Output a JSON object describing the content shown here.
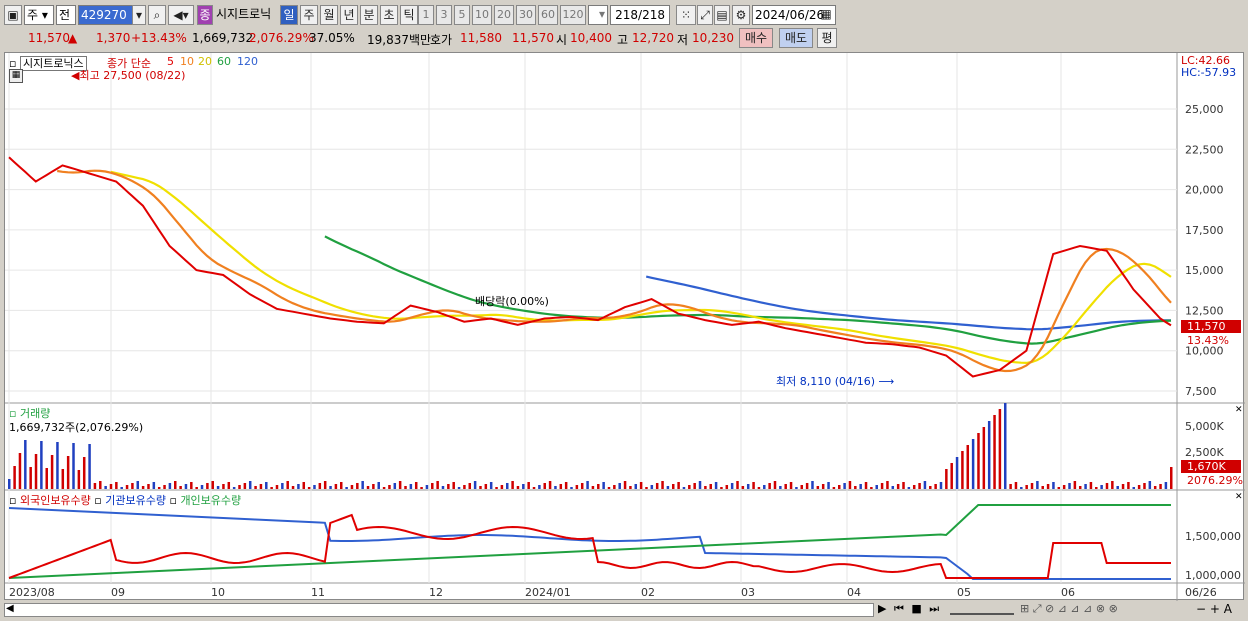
{
  "toolbar": {
    "market_select": "주",
    "type_select": "전",
    "code": "429270",
    "stock_badge": "종",
    "stock_name": "시지트로닉",
    "periods": [
      "일",
      "주",
      "월",
      "년",
      "분",
      "초",
      "틱"
    ],
    "numbers": [
      "1",
      "3",
      "5",
      "10",
      "20",
      "30",
      "60",
      "120"
    ],
    "count": "218/218",
    "date": "2024/06/26"
  },
  "info": {
    "price": "11,570",
    "change": "1,370",
    "change_pct": "+13.43%",
    "volume": "1,669,732",
    "volume_pct": "2,076.29%",
    "turnover": "37.05%",
    "amount": "19,837백만",
    "ask_label": "호가",
    "ask": "11,580",
    "bid": "11,570",
    "open_label": "시",
    "open": "10,400",
    "high_label": "고",
    "high": "12,720",
    "low_label": "저",
    "low": "10,230",
    "buy_button": "매수",
    "sell_button": "매도",
    "eval_button": "평"
  },
  "price_panel": {
    "title": "시지트로닉스",
    "legend_title": "종가 단순",
    "ma_labels": [
      "5",
      "10",
      "20",
      "60",
      "120"
    ],
    "ma_colors": [
      "#e00000",
      "#f08020",
      "#f0e000",
      "#20a040",
      "#3060d0"
    ],
    "high_note": "최고 27,500 (08/22)",
    "low_note": "최저 8,110 (04/16)",
    "event_note": "배당락(0.00%)",
    "lc": "LC:42.66",
    "hc": "HC:-57.93",
    "price_tag": "11,570",
    "price_tag_pct": "13.43%"
  },
  "volume_panel": {
    "title": "거래량",
    "value": "1,669,732주(2,076.29%)",
    "tag": "1,670K",
    "tag_pct": "2076.29%"
  },
  "holding_panel": {
    "items": [
      "외국인보유수량",
      "기관보유수량",
      "개인보유수량"
    ]
  },
  "chart_data": {
    "type": "line",
    "price_axis": [
      "25,000",
      "22,500",
      "20,000",
      "17,500",
      "15,000",
      "12,500",
      "10,000",
      "7,500"
    ],
    "price_axis_values": [
      25000,
      22500,
      20000,
      17500,
      15000,
      12500,
      10000,
      7500
    ],
    "volume_axis": [
      "5,000K",
      "2,500K"
    ],
    "holding_axis": [
      "1,500,000",
      "1,000,000"
    ],
    "x_labels": [
      "2023/08",
      "09",
      "10",
      "11",
      "12",
      "2024/01",
      "02",
      "03",
      "04",
      "05",
      "06",
      "06/26"
    ],
    "close_series": {
      "name": "5",
      "x": [
        0,
        5,
        10,
        15,
        20,
        25,
        30,
        35,
        40,
        45,
        50,
        55,
        60,
        65,
        70,
        75,
        80,
        85,
        90,
        95,
        100,
        105,
        110,
        115,
        120,
        125,
        130,
        135,
        140,
        145,
        150,
        155,
        160,
        165,
        170,
        175,
        180,
        185,
        190,
        195,
        200,
        205,
        210,
        215,
        217
      ],
      "values": [
        22000,
        20500,
        21500,
        21000,
        20500,
        19000,
        16500,
        15000,
        14700,
        13500,
        12600,
        12300,
        12000,
        11800,
        11700,
        12800,
        12400,
        11800,
        12000,
        11600,
        12000,
        12100,
        11900,
        12700,
        13200,
        12300,
        11900,
        11600,
        11800,
        11400,
        11100,
        10800,
        10500,
        10400,
        10200,
        9700,
        8400,
        8800,
        10000,
        16000,
        16500,
        16200,
        13800,
        12000,
        11570
      ]
    }
  }
}
